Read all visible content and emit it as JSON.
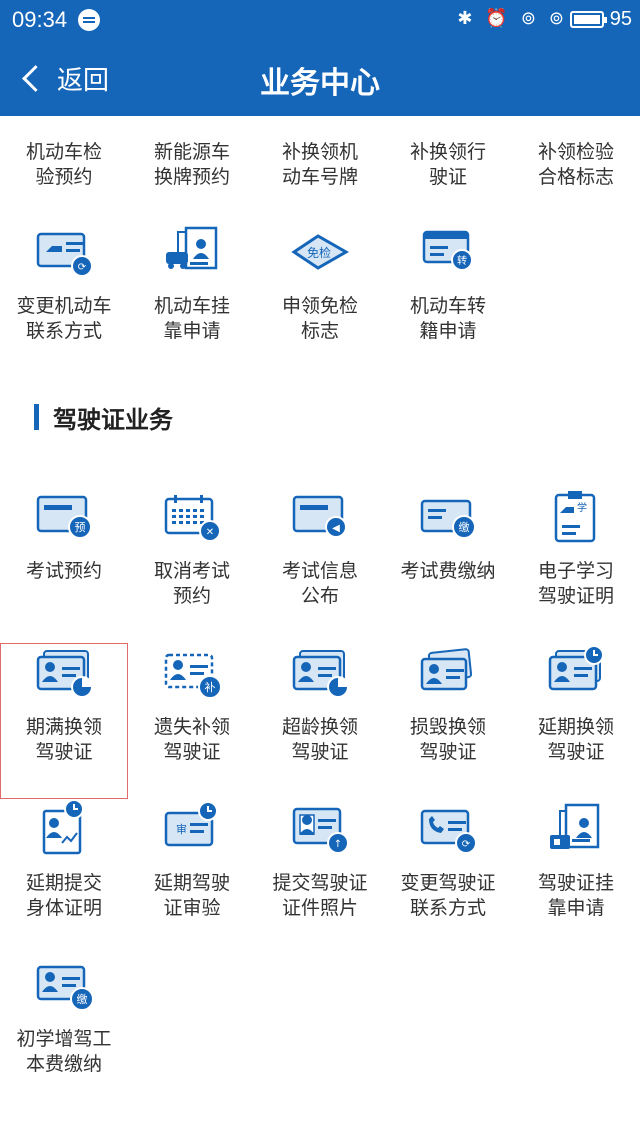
{
  "status_bar": {
    "time": "09:34",
    "icons": "✱ ⏰ ⊚ ⊚",
    "battery": "95"
  },
  "header": {
    "back_label": "返回",
    "title": "业务中心"
  },
  "vehicle_partial": [
    {
      "label": "机动车检\n验预约",
      "icon": "calendar-icon"
    },
    {
      "label": "新能源车\n换牌预约",
      "icon": "plate-icon"
    },
    {
      "label": "补换领机\n动车号牌",
      "icon": "plate-icon"
    },
    {
      "label": "补换领行\n驶证",
      "icon": "card-icon"
    },
    {
      "label": "补领检验\n合格标志",
      "icon": "badge-icon"
    }
  ],
  "vehicle_row2": [
    {
      "label": "变更机动车\n联系方式",
      "icon": "car-card-refresh-icon"
    },
    {
      "label": "机动车挂\n靠申请",
      "icon": "car-document-icon"
    },
    {
      "label": "申领免检\n标志",
      "icon": "exempt-badge-icon",
      "badge": "免检"
    },
    {
      "label": "机动车转\n籍申请",
      "icon": "card-transfer-icon",
      "badge": "转"
    }
  ],
  "section": {
    "title": "驾驶证业务"
  },
  "license_items": [
    {
      "label": "考试预约",
      "icon": "card-booking-icon",
      "badge": "预"
    },
    {
      "label": "取消考试\n预约",
      "icon": "calendar-cancel-icon"
    },
    {
      "label": "考试信息\n公布",
      "icon": "card-announce-icon"
    },
    {
      "label": "考试费缴纳",
      "icon": "card-payment-icon",
      "badge": "缴"
    },
    {
      "label": "电子学习\n驾驶证明",
      "icon": "clipboard-learn-icon",
      "badge": "学"
    },
    {
      "label": "期满换领\n驾驶证",
      "icon": "license-expire-icon"
    },
    {
      "label": "遗失补领\n驾驶证",
      "icon": "license-lost-icon",
      "badge": "补"
    },
    {
      "label": "超龄换领\n驾驶证",
      "icon": "license-age-icon"
    },
    {
      "label": "损毁换领\n驾驶证",
      "icon": "license-damaged-icon"
    },
    {
      "label": "延期换领\n驾驶证",
      "icon": "license-delay-icon"
    },
    {
      "label": "延期提交\n身体证明",
      "icon": "health-report-icon"
    },
    {
      "label": "延期驾驶\n证审验",
      "icon": "license-audit-icon",
      "badge": "审"
    },
    {
      "label": "提交驾驶证\n证件照片",
      "icon": "photo-upload-icon"
    },
    {
      "label": "变更驾驶证\n联系方式",
      "icon": "phone-card-refresh-icon"
    },
    {
      "label": "驾驶证挂\n靠申请",
      "icon": "license-document-icon"
    },
    {
      "label": "初学增驾工\n本费缴纳",
      "icon": "license-payment-icon",
      "badge": "缴"
    }
  ],
  "colors": {
    "primary": "#1565b8",
    "icon_fill": "#d6e6f5",
    "selected_border": "#e16a6a"
  }
}
